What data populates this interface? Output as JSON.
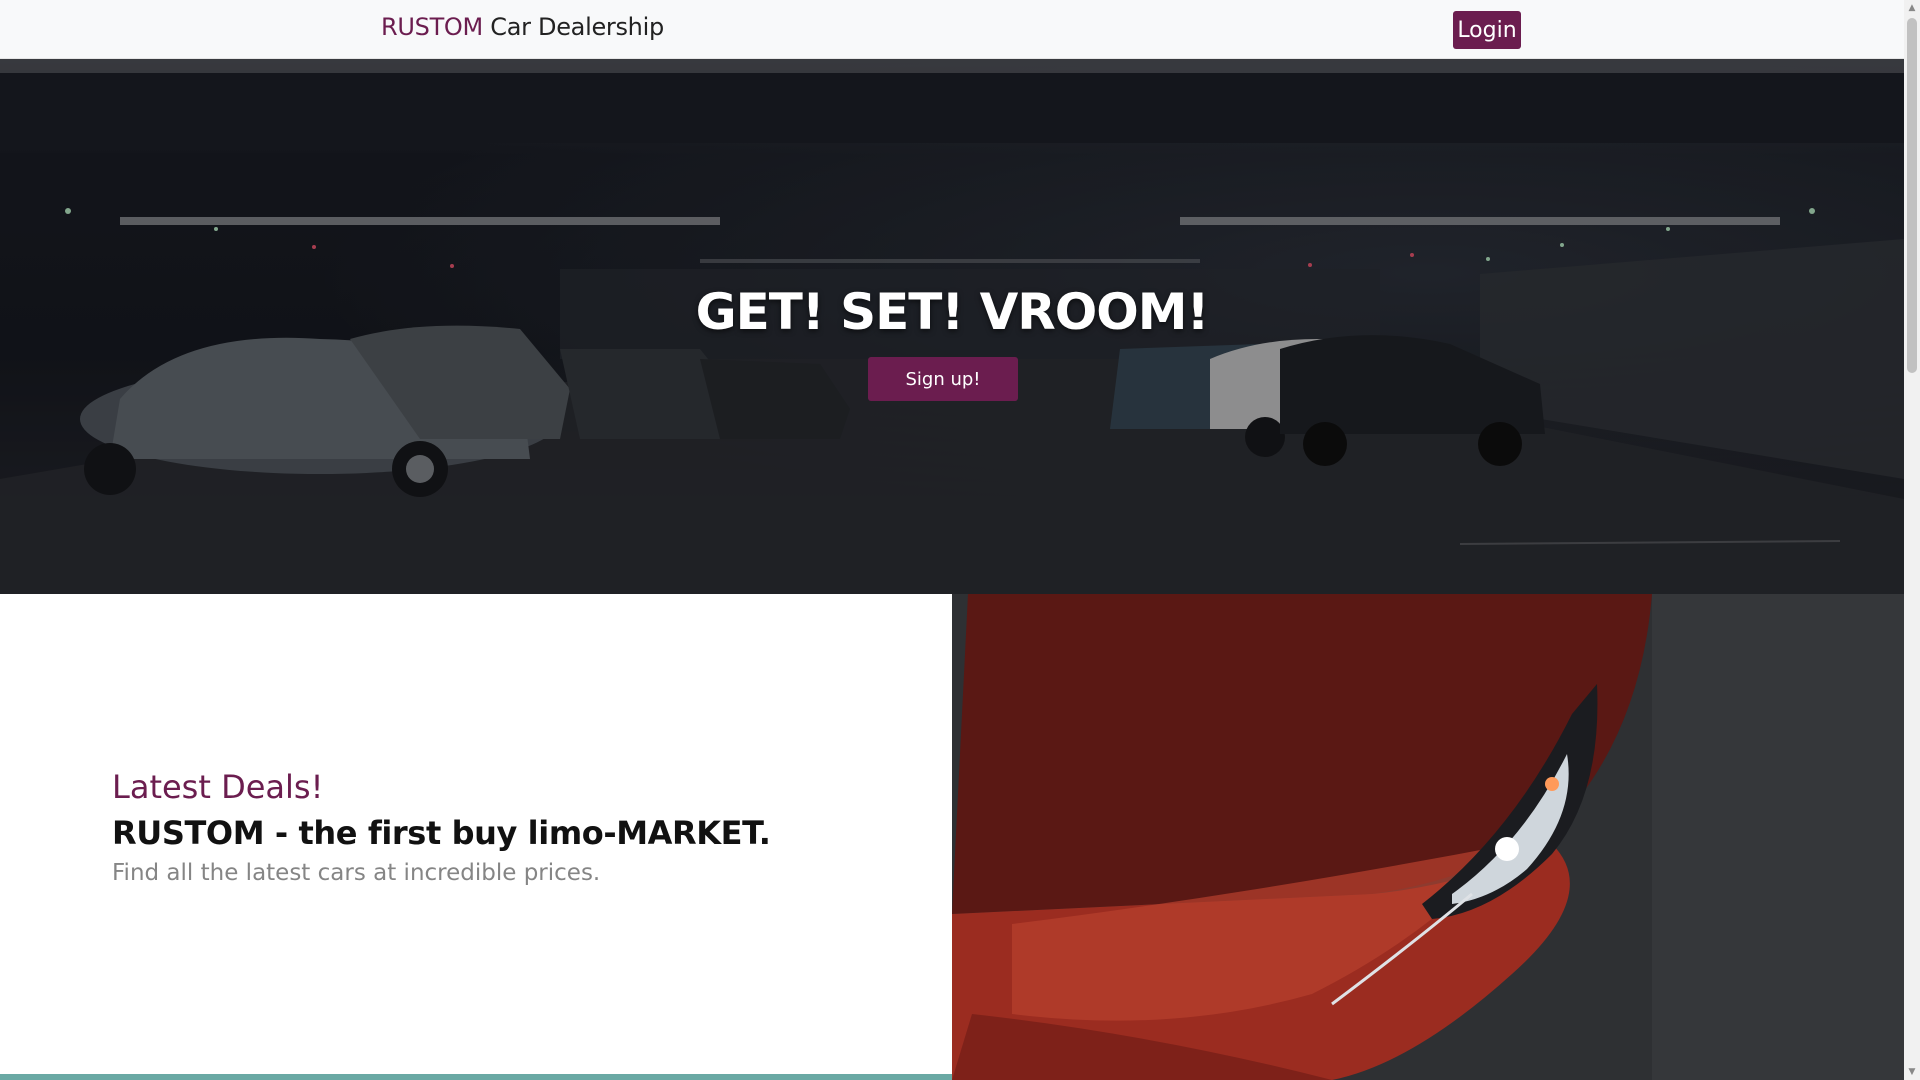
{
  "navbar": {
    "brand_accent": "RUSTOM",
    "brand_rest": " Car Dealership",
    "login_label": "Login"
  },
  "hero": {
    "title": "GET! SET! VROOM!",
    "signup_label": "Sign up!"
  },
  "deals": {
    "heading": "Latest Deals!",
    "title": "RUSTOM - the first buy limo-MARKET.",
    "subtitle": "Find all the latest cars at incredible prices."
  },
  "colors": {
    "accent": "#6b1d4f",
    "navbar_bg": "#f8f9fa",
    "teal": "#6aa9a4"
  }
}
